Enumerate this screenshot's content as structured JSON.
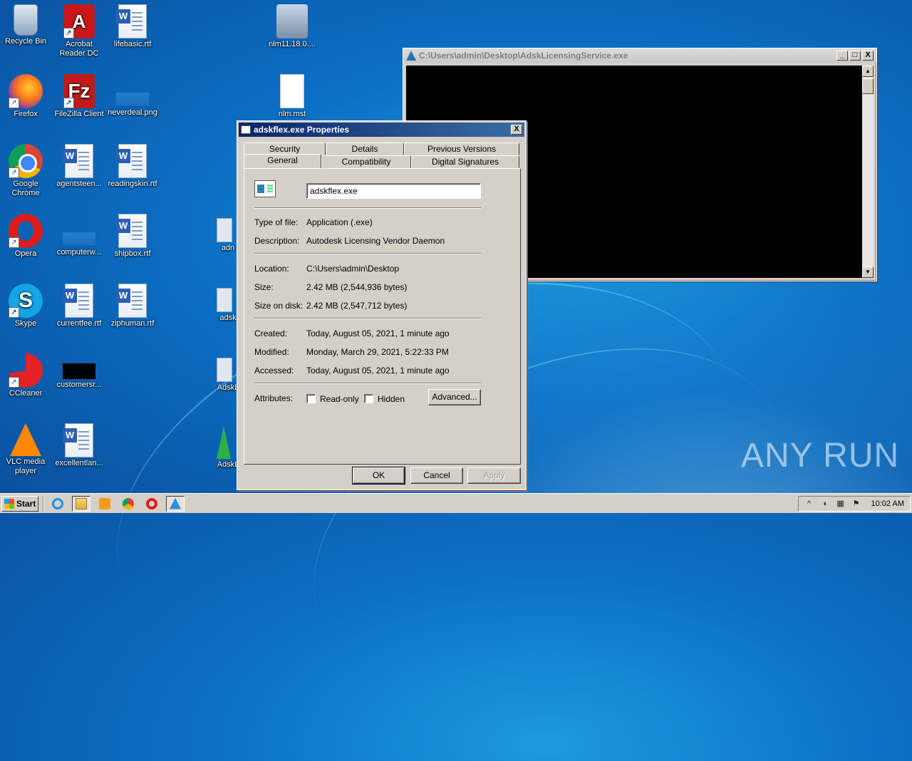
{
  "desktop": {
    "icons": [
      {
        "label": "Recycle Bin"
      },
      {
        "label": "Acrobat Reader DC"
      },
      {
        "label": "lifebasic.rtf"
      },
      {
        "label": "nlm11.18.0...."
      },
      {
        "label": "Firefox"
      },
      {
        "label": "FileZilla Client"
      },
      {
        "label": "neverdeal.png"
      },
      {
        "label": "nlm.mst"
      },
      {
        "label": "Google Chrome"
      },
      {
        "label": "agentsteen..."
      },
      {
        "label": "readingskin.rtf"
      },
      {
        "label": "Opera"
      },
      {
        "label": "computerw..."
      },
      {
        "label": "shipbox.rtf"
      },
      {
        "label": "adn"
      },
      {
        "label": "Skype"
      },
      {
        "label": "currentfee.rtf"
      },
      {
        "label": "ziphuman.rtf"
      },
      {
        "label": "adsk"
      },
      {
        "label": "CCleaner"
      },
      {
        "label": "customersr..."
      },
      {
        "label": "AdskL"
      },
      {
        "label": "VLC media player"
      },
      {
        "label": "excellentlan..."
      },
      {
        "label": "AdskL"
      }
    ],
    "watermark": "ANY RUN"
  },
  "console_window": {
    "title": "C:\\Users\\admin\\Desktop\\AdskLicensingService.exe",
    "buttons": [
      "_",
      "□",
      "X"
    ]
  },
  "properties_dialog": {
    "title": "adskflex.exe Properties",
    "close": "X",
    "tabs_back": [
      "Security",
      "Details",
      "Previous Versions"
    ],
    "tabs_front": [
      "General",
      "Compatibility",
      "Digital Signatures"
    ],
    "active_tab": "General",
    "file_name": "adskflex.exe",
    "fields": {
      "type_label": "Type of file:",
      "type_value": "Application (.exe)",
      "desc_label": "Description:",
      "desc_value": "Autodesk Licensing Vendor Daemon",
      "location_label": "Location:",
      "location_value": "C:\\Users\\admin\\Desktop",
      "size_label": "Size:",
      "size_value": "2.42 MB (2,544,936 bytes)",
      "size_disk_label": "Size on disk:",
      "size_disk_value": "2.42 MB (2,547,712 bytes)",
      "created_label": "Created:",
      "created_value": "Today, August 05, 2021, 1 minute ago",
      "modified_label": "Modified:",
      "modified_value": "Monday, March 29, 2021, 5:22:33 PM",
      "accessed_label": "Accessed:",
      "accessed_value": "Today, August 05, 2021, 1 minute ago"
    },
    "attributes_label": "Attributes:",
    "readonly_label": "Read-only",
    "hidden_label": "Hidden",
    "advanced_label": "Advanced...",
    "ok_label": "OK",
    "cancel_label": "Cancel",
    "apply_label": "Apply"
  },
  "taskbar": {
    "start_label": "Start",
    "clock": "10:02 AM",
    "tray_expand": "^"
  }
}
